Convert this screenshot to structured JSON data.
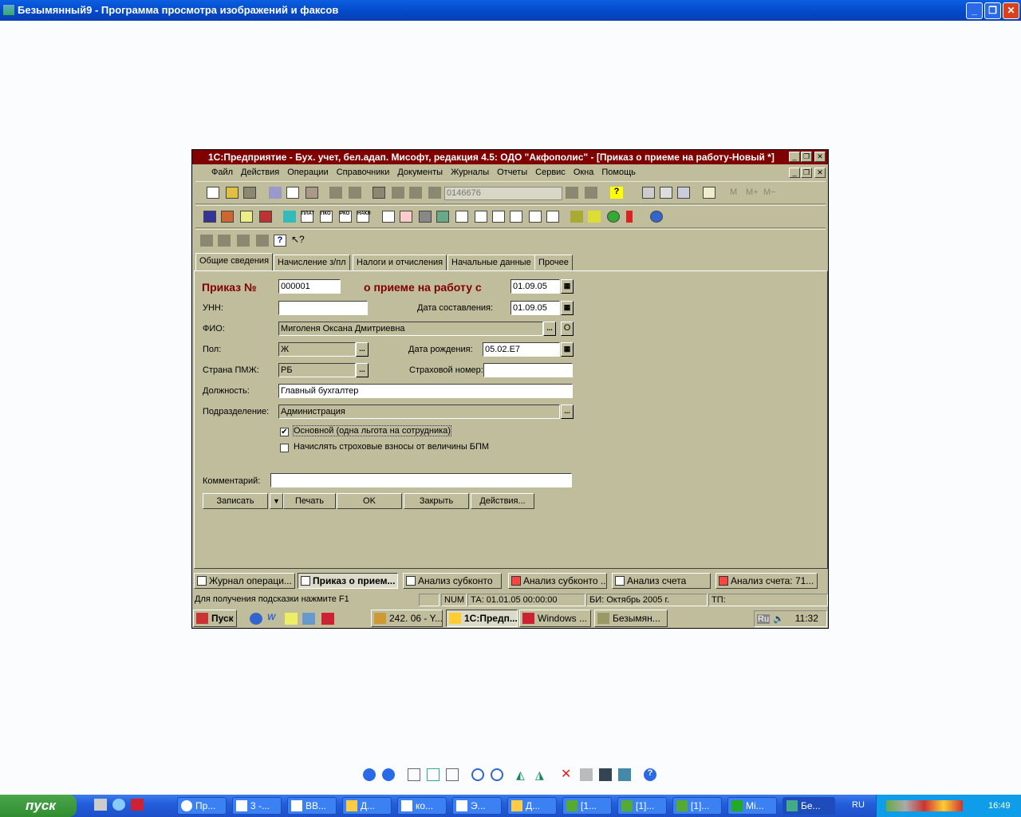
{
  "viewer": {
    "title": "Безымянный9 - Программа просмотра изображений и факсов"
  },
  "app": {
    "title": "1С:Предприятие - Бух. учет, бел.адап. Мисофт, редакция 4.5: ОДО \"Акфополис\" - [Приказ о приеме на работу-Новый *]",
    "menu": [
      "Файл",
      "Действия",
      "Операции",
      "Справочники",
      "Документы",
      "Журналы",
      "Отчеты",
      "Сервис",
      "Окна",
      "Помощь"
    ],
    "toolbar_combo": "0146676",
    "toolbar_labels": [
      "ПЛАТ",
      "ПКО",
      "РКО",
      "НАКЛ"
    ],
    "calc_labels": [
      "M",
      "M+",
      "M−"
    ],
    "tabs": [
      "Общие сведения",
      "Начисление з/пл",
      "Налоги и отчисления",
      "Начальные данные",
      "Прочее"
    ],
    "form": {
      "order_label": "Приказ №",
      "order_number": "000001",
      "hire_label": "о приеме на работу с",
      "hire_date": "01.09.05",
      "unn_label": "УНН:",
      "unn": "",
      "compose_label": "Дата составления:",
      "compose_date": "01.09.05",
      "fio_label": "ФИО:",
      "fio": "Миголеня Оксана Дмитриевна",
      "fio_o": "О",
      "sex_label": "Пол:",
      "sex": "Ж",
      "birth_label": "Дата рождения:",
      "birth": "05.02.Е7",
      "country_label": "Страна ПМЖ:",
      "country": "РБ",
      "insurance_label": "Страховой номер:",
      "insurance": "",
      "position_label": "Должность:",
      "position": "Главный бухгалтер",
      "dept_label": "Подразделение:",
      "dept": "Администрация",
      "check1": "Основной (одна льгота  на сотрудника)",
      "check1_checked": true,
      "check2": "Начислять строховые взносы от величины БПМ",
      "check2_checked": false,
      "comment_label": "Комментарий:",
      "comment": "",
      "buttons": [
        "Записать",
        "Печать",
        "OK",
        "Закрыть",
        "Действия..."
      ]
    },
    "windows": [
      "Журнал операци...",
      "Приказ о прием...",
      "Анализ субконто",
      "Анализ субконто ...",
      "Анализ счета",
      "Анализ счета: 71..."
    ],
    "status": {
      "hint": "Для получения подсказки нажмите F1",
      "num": "NUM",
      "ta": "ТА: 01.01.05  00:00:00",
      "bi": "БИ: Октябрь 2005 г.",
      "tp": "ТП:"
    },
    "inner_taskbar": {
      "start": "Пуск",
      "tasks": [
        "242. 06 - Y...",
        "1С:Предп...",
        "Windows ...",
        "Безымян..."
      ],
      "lang": "Ru",
      "time": "11:32"
    }
  },
  "taskbar": {
    "start": "пуск",
    "tasks": [
      "Пр...",
      "3 -...",
      "ВВ...",
      "Д...",
      "ко...",
      "Э...",
      "Д...",
      "[1...",
      "[1]...",
      "[1]...",
      "Mi...",
      "Бе..."
    ],
    "lang": "RU",
    "time": "16:49"
  }
}
